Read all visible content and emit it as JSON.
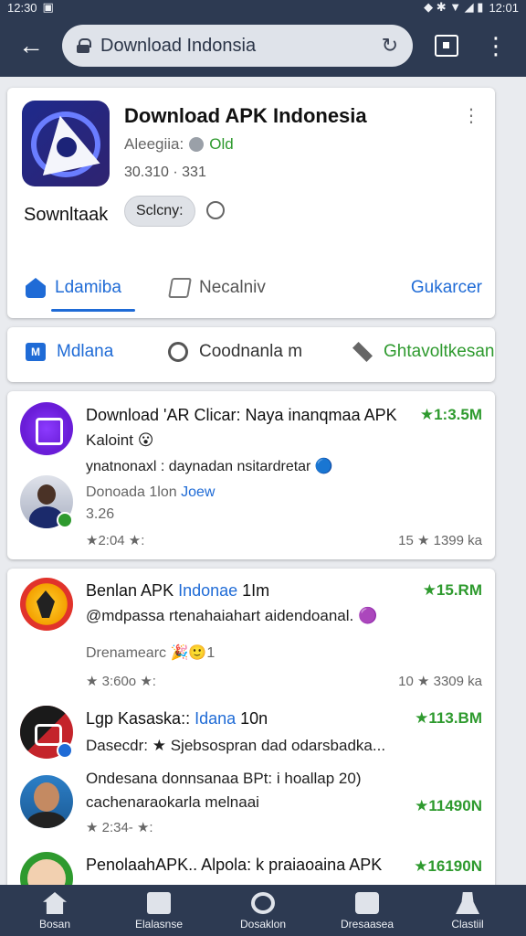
{
  "status": {
    "time": "12:30",
    "right": "12:01"
  },
  "browser": {
    "url": "Download Indonsia"
  },
  "app": {
    "title": "Download APK Indonesia",
    "dev_label": "Aleegiia:",
    "dev_value": "Old",
    "stats": "30.310 · 331",
    "name2": "Sownltaak",
    "chip": "Sclcny:"
  },
  "tabs": [
    {
      "label": "Ldamiba"
    },
    {
      "label": "Necalniv"
    },
    {
      "label": "Gukarcer"
    }
  ],
  "categories": [
    {
      "label": "Mdlana",
      "icon": "M"
    },
    {
      "label": "Coodnanla m"
    },
    {
      "label": "Ghtavoltkesan"
    }
  ],
  "list": [
    {
      "title": "Download 'AR Clicar: Naya inanqmaa APK",
      "line1": "Kaloint 😮",
      "line2": "ynatnonaxl : daynadan nsitardretar 🔵",
      "size": "★1:3.5M",
      "sub": "Donoada 1lon",
      "sub_tag": "Joew",
      "sub2": "3.26",
      "meta_left": "★2:04   ★:",
      "meta_right": "15 ★ 1399 ka"
    },
    {
      "title_a": "Benlan APK ",
      "title_b": "Indonae",
      "title_c": " 1Im",
      "size": "★15.RM",
      "line1": "@mdpassa rtenahaiahart aidendoanal. 🟣",
      "sub": "Drenamearc  🎉🙂1",
      "meta_left": "★ 3:60o   ★:",
      "meta_right": "10 ★ 3309 ka"
    },
    {
      "title_a": "Lgp Kasaska:: ",
      "title_b": "Idana",
      "title_c": " 10n",
      "size": "★113.BM",
      "line1": "Dasecdr: ★ Sjebsospran dad odarsbadka..."
    },
    {
      "line1": "Ondesana donnsanaa BPt: i hoallap 20)",
      "line2": "cachenaraokarla melnaai",
      "size": "★11490N",
      "meta_left": "★ 2:34-   ★:"
    },
    {
      "title": "PenolaahAPK.. Alpola: k praiaoaina APK",
      "size": "★16190N"
    }
  ],
  "nav": [
    {
      "label": "Bosan"
    },
    {
      "label": "Elalasnse"
    },
    {
      "label": "Dosaklon"
    },
    {
      "label": "Dresaasea"
    },
    {
      "label": "Clastiil"
    }
  ],
  "colors": {
    "bar": "#2d3a52",
    "accent": "#1f6bd6",
    "size_green": "#2e9a2e",
    "star": "#f4b400"
  }
}
